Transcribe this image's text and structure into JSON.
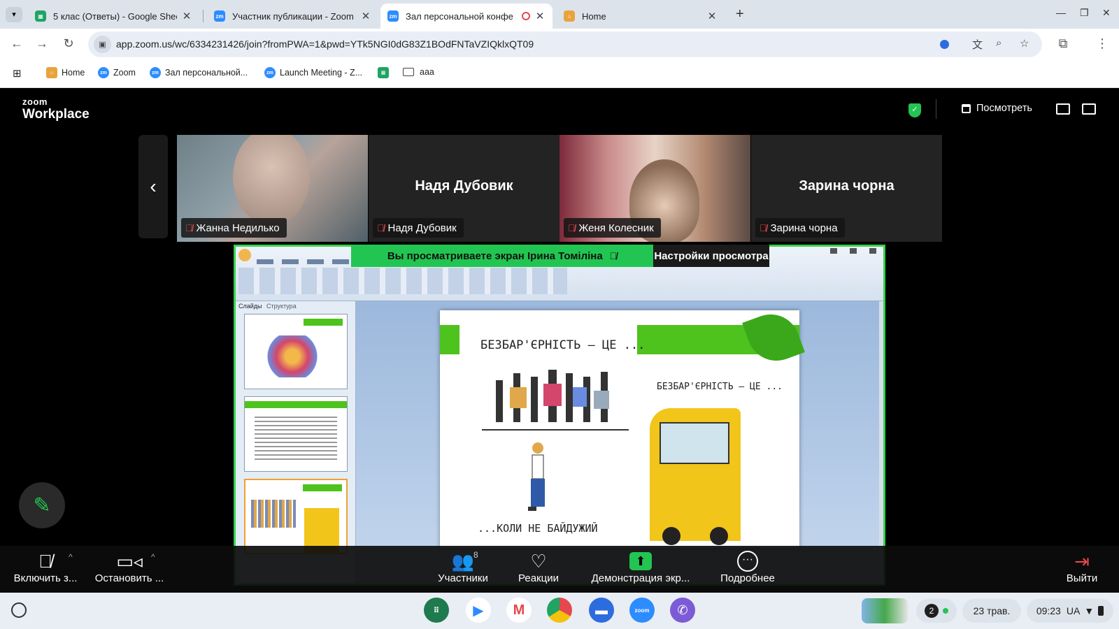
{
  "browser": {
    "tabs": [
      {
        "title": "5 клас (Ответы) - Google Shee",
        "favicon": "sheets-icon",
        "color": "#1fa463"
      },
      {
        "title": "Участник публикации - Zoom",
        "favicon": "zoom-icon",
        "color": "#2d8cff"
      },
      {
        "title": "Зал персональной конфе",
        "favicon": "zoom-icon",
        "color": "#2d8cff"
      },
      {
        "title": "Home",
        "favicon": "home-icon",
        "color": "#e8a33d"
      }
    ],
    "url": "app.zoom.us/wc/6334231426/join?fromPWA=1&pwd=YTk5NGI0dG83Z1BOdFNTaVZIQklxQT09",
    "bookmarks": [
      {
        "label": "Home",
        "icon": "home-icon"
      },
      {
        "label": "Zoom",
        "icon": "zoom-icon"
      },
      {
        "label": "Зал персональной...",
        "icon": "zoom-icon"
      },
      {
        "label": "Launch Meeting - Z...",
        "icon": "zoom-icon"
      },
      {
        "label": "",
        "icon": "sheets-icon"
      },
      {
        "label": "ааа",
        "icon": "folder-icon"
      }
    ]
  },
  "zoom": {
    "logo_top": "zoom",
    "logo_bottom": "Workplace",
    "view_label": "Посмотреть",
    "participants": [
      {
        "name": "Жанна Недилько",
        "muted": true,
        "video": true
      },
      {
        "name": "Надя Дубовик",
        "muted": true,
        "video": false
      },
      {
        "name": "Женя Колесник",
        "muted": true,
        "video": true
      },
      {
        "name": "Зарина чорна",
        "muted": true,
        "video": false
      }
    ],
    "banner_text": "Вы просматриваете экран  Ірина Томіліна",
    "view_settings": "Настройки просмотра",
    "slide": {
      "title_left": "БЕЗБАР'ЄРНІСТЬ — ЦЕ ...",
      "title_right": "БЕЗБАР'ЄРНІСТЬ — ЦЕ ...",
      "caption_left": "...КОЛИ НЕ БАЙДУЖИЙ"
    },
    "pane_tabs": [
      "Слайды",
      "Структура"
    ],
    "controls": {
      "mic": "Включить з...",
      "video": "Остановить ...",
      "participants": "Участники",
      "participants_count": "8",
      "reactions": "Реакции",
      "share": "Демонстрация экр...",
      "more": "Подробнее",
      "leave": "Выйти"
    },
    "colors": {
      "accent": "#23c552",
      "muted": "#e5484d"
    }
  },
  "shelf": {
    "notifications": "2",
    "date": "23 трав.",
    "time": "09:23",
    "locale": "UA"
  }
}
